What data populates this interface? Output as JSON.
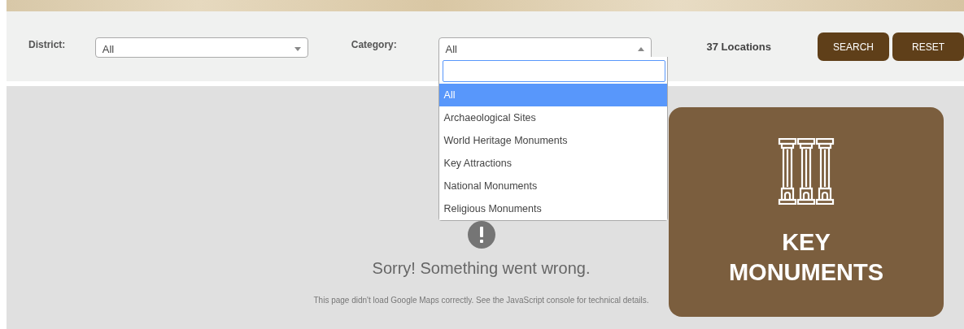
{
  "filters": {
    "district": {
      "label": "District:",
      "value": "All",
      "expanded": false
    },
    "category": {
      "label": "Category:",
      "value": "All",
      "expanded": true,
      "options": [
        {
          "label": "All",
          "selected": true
        },
        {
          "label": "Archaeological Sites",
          "selected": false
        },
        {
          "label": "World Heritage Monuments",
          "selected": false
        },
        {
          "label": "Key Attractions",
          "selected": false
        },
        {
          "label": "National Monuments",
          "selected": false
        },
        {
          "label": "Religious Monuments",
          "selected": false
        }
      ]
    },
    "count": "37 Locations",
    "buttons": [
      "SEARCH",
      "RESET"
    ]
  },
  "map": {
    "error_title": "Sorry! Something went wrong.",
    "error_detail": "This page didn't load Google Maps correctly. See the JavaScript console for technical details."
  },
  "card": {
    "title": "KEY MONUMENTS"
  }
}
